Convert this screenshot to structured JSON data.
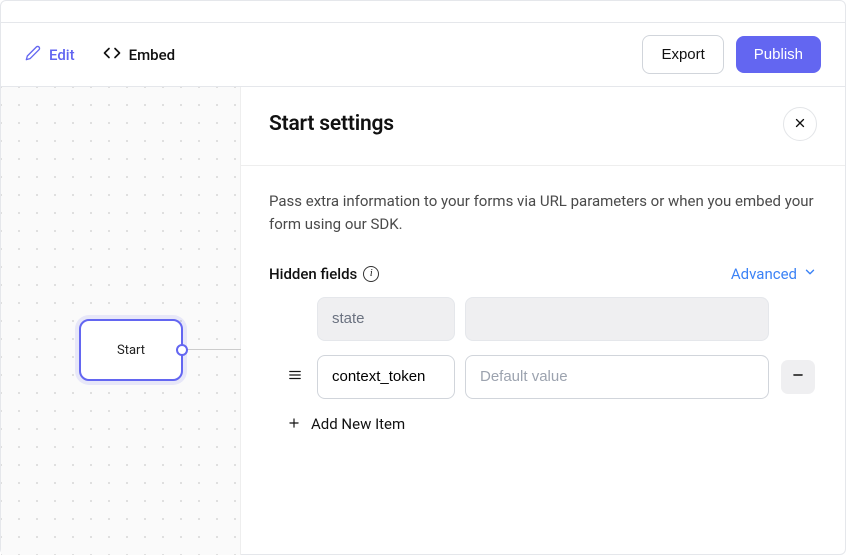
{
  "toolbar": {
    "edit_label": "Edit",
    "embed_label": "Embed",
    "export_label": "Export",
    "publish_label": "Publish"
  },
  "canvas": {
    "start_node_label": "Start"
  },
  "panel": {
    "title": "Start settings",
    "description": "Pass extra information to your forms via URL parameters or when you embed your form using our SDK.",
    "section_label": "Hidden fields",
    "advanced_label": "Advanced",
    "add_item_label": "Add New Item",
    "fields": [
      {
        "name": "state",
        "value": "",
        "placeholder": "",
        "locked": true
      },
      {
        "name": "context_token",
        "value": "",
        "placeholder": "Default value",
        "locked": false
      }
    ]
  },
  "icons": {
    "edit": "pencil-icon",
    "embed": "code-icon",
    "close": "close-icon",
    "info": "info-icon",
    "chevron": "chevron-down-icon",
    "drag": "drag-handle-icon",
    "minus": "minus-icon",
    "plus": "plus-icon"
  },
  "colors": {
    "accent": "#6366f1",
    "link": "#3b82f6"
  }
}
